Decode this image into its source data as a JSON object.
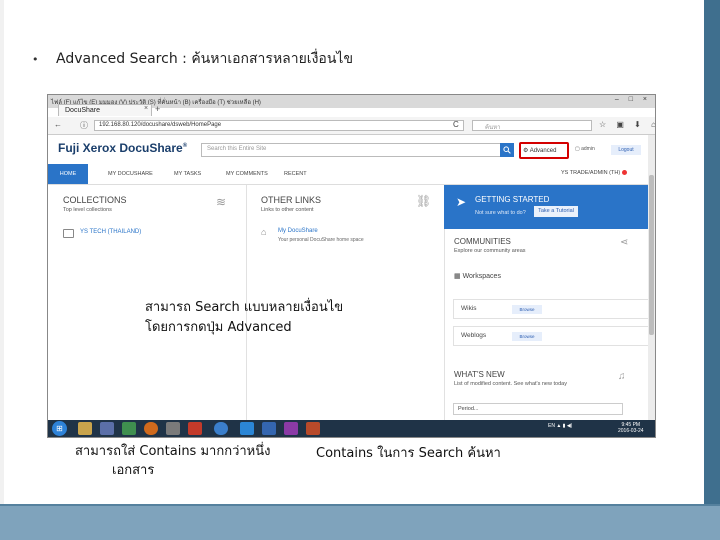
{
  "slide": {
    "bullet": "•",
    "heading": "Advanced Search : ค้นหาเอกสารหลายเงื่อนไข",
    "note_advanced_line1": "สามารถ Search แบบหลายเงื่อนไข",
    "note_advanced_line2": "โดยการกดปุ่ม    Advanced",
    "note_contains_line1": "สามารถใส่   Contains มากกว่าหนึ่ง",
    "note_contains_line2": "เอกสาร",
    "note_contains_right": "Contains ในการ Search ค้นหา",
    "colors": {
      "frame": "#3f6f8e",
      "frame_light": "#7fa3bc",
      "accent": "#2a74c8",
      "highlight": "#d40000"
    }
  },
  "browser": {
    "menu": "ไฟล์ (F)   แก้ไข (E)   มุมมอง (V)   ประวัติ (S)   ที่คั่นหน้า (B)   เครื่องมือ (T)   ช่วยเหลือ (H)",
    "tab_title": "DocuShare",
    "tab_close": "×",
    "tab_new": "+",
    "window_controls": "– □ ×",
    "back_icon": "←",
    "info_icon": "ⓘ",
    "url": "192.168.80.120/docushare/dsweb/HomePage",
    "reload_icon": "C",
    "search_placeholder": "ค้นหา",
    "toolbar_icons": "☆ ▣ ⬇ ⌂ ≡"
  },
  "app": {
    "logo": "Fuji Xerox DocuShare",
    "logo_mark": "®",
    "site_search_placeholder": "Search this Entire Site",
    "search_icon": "search-icon",
    "advanced_label": "⚙ Advanced",
    "user_label": "▢  admin",
    "logout_label": "Logout",
    "nav": [
      "HOME",
      "MY DOCUSHARE",
      "MY TASKS",
      "MY COMMENTS",
      "RECENT"
    ],
    "nav_right": "YS TRADE/ADMIN (TH)",
    "collections": {
      "title": "COLLECTIONS",
      "sub": "Top level collections",
      "item": "YS TECH (THAILAND)"
    },
    "other_links": {
      "title": "OTHER LINKS",
      "sub": "Links to other content",
      "item": "My DocuShare",
      "item_sub": "Your personal DocuShare home space"
    },
    "getting_started": {
      "title": "GETTING STARTED",
      "sub": "Not sure what to do?",
      "button": "Take a Tutorial"
    },
    "communities": {
      "title": "COMMUNITIES",
      "sub": "Explore our community areas"
    },
    "workspaces": {
      "title": "Workspaces",
      "rows": [
        {
          "label": "Wikis",
          "chip": "Browse"
        },
        {
          "label": "Weblogs",
          "chip": "Browse"
        }
      ]
    },
    "whats_new": {
      "title": "WHAT'S NEW",
      "sub": "List of modified content. See what's new today",
      "select": "Period..."
    }
  },
  "taskbar": {
    "start": "⊞",
    "tray": "EN  ▲  ▮ ◀)",
    "clock_time": "9:45 PM",
    "clock_date": "2016-03-24"
  }
}
